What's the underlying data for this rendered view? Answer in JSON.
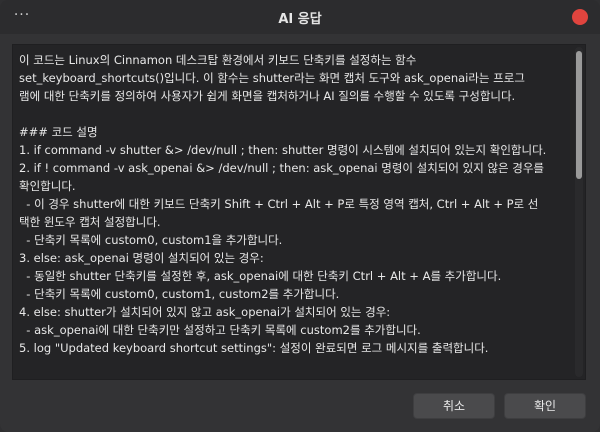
{
  "window": {
    "title": "AI 응답",
    "menu_icon": "ellipsis-icon",
    "close_icon": "close-icon",
    "close_color": "#e0443e"
  },
  "content": {
    "lines": [
      "이 코드는 Linux의 Cinnamon 데스크탑 환경에서 키보드 단축키를 설정하는 함수",
      "set_keyboard_shortcuts()입니다. 이 함수는 shutter라는 화면 캡처 도구와 ask_openai라는 프로그",
      "램에 대한 단축키를 정의하여 사용자가 쉽게 화면을 캡처하거나 AI 질의를 수행할 수 있도록 구성합니다.",
      "",
      "### 코드 설명",
      "1. if command -v shutter &> /dev/null ; then: shutter 명령이 시스템에 설치되어 있는지 확인합니다.",
      "2. if ! command -v ask_openai &> /dev/null ; then: ask_openai 명령이 설치되어 있지 않은 경우를",
      "확인합니다.",
      "  - 이 경우 shutter에 대한 키보드 단축키 Shift + Ctrl + Alt + P로 특정 영역 캡처, Ctrl + Alt + P로 선",
      "택한 윈도우 캡처 설정합니다.",
      "  - 단축키 목록에 custom0, custom1을 추가합니다.",
      "3. else: ask_openai 명령이 설치되어 있는 경우:",
      "  - 동일한 shutter 단축키를 설정한 후, ask_openai에 대한 단축키 Ctrl + Alt + A를 추가합니다.",
      "  - 단축키 목록에 custom0, custom1, custom2를 추가합니다.",
      "4. else: shutter가 설치되어 있지 않고 ask_openai가 설치되어 있는 경우:",
      "  - ask_openai에 대한 단축키만 설정하고 단축키 목록에 custom2를 추가합니다.",
      "5. log \"Updated keyboard shortcut settings\": 설정이 완료되면 로그 메시지를 출력합니다."
    ]
  },
  "buttons": {
    "cancel_label": "취소",
    "ok_label": "확인"
  }
}
